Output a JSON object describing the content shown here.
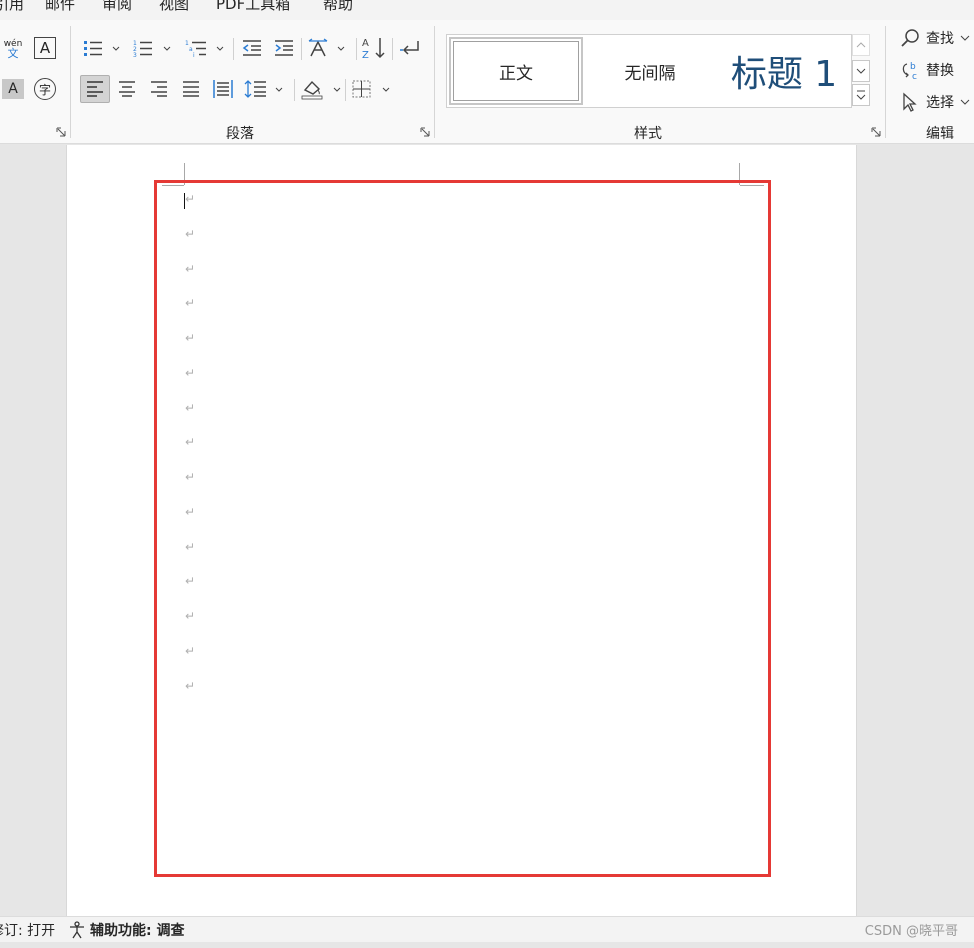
{
  "tabs": [
    "引用",
    "邮件",
    "审阅",
    "视图",
    "PDF工具箱",
    "帮助"
  ],
  "ribbon": {
    "groups": {
      "paragraph_label": "段落",
      "styles_label": "样式",
      "editing_label": "编辑"
    },
    "font_row": {
      "phonetic_top": "wén",
      "phonetic_bottom": "文",
      "char_border": "A",
      "char_shading": "A",
      "enclosed_char": "字"
    },
    "styles": {
      "items": [
        "正文",
        "无间隔",
        "标题 1"
      ],
      "heading_color": "#1f4e79"
    },
    "editing": {
      "find_label": "查找",
      "replace_label": "替换",
      "select_label": "选择"
    }
  },
  "document": {
    "paragraph_mark": "↵",
    "paragraph_count": 15
  },
  "statusbar": {
    "track_changes": "修订: 打开",
    "accessibility": "辅助功能: 调查"
  },
  "watermark": "CSDN @晓平哥",
  "colors": {
    "highlight_box": "#e53935",
    "accent_blue": "#2b7cd3"
  }
}
